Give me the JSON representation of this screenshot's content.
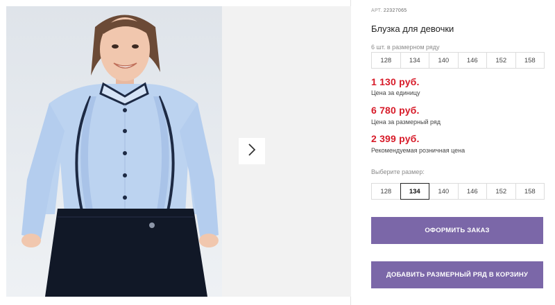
{
  "product": {
    "article_label": "АРТ.",
    "article_number": "22327065",
    "title": "Блузка для девочки"
  },
  "pack": {
    "caption": "6 шт. в размерном ряду",
    "sizes": [
      "128",
      "134",
      "140",
      "146",
      "152",
      "158"
    ]
  },
  "prices": [
    {
      "amount": "1 130 руб.",
      "caption": "Цена за единицу"
    },
    {
      "amount": "6 780 руб.",
      "caption": "Цена за размерный ряд"
    },
    {
      "amount": "2 399 руб.",
      "caption": "Рекомендуемая розничная цена"
    }
  ],
  "size_select": {
    "caption": "Выберите размер:",
    "sizes": [
      "128",
      "134",
      "140",
      "146",
      "152",
      "158"
    ],
    "selected": "134"
  },
  "buttons": {
    "order": "ОФОРМИТЬ ЗАКАЗ",
    "add_pack": "ДОБАВИТЬ РАЗМЕРНЫЙ РЯД В КОРЗИНУ"
  },
  "colors": {
    "price": "#d71a28",
    "button": "#7b67a8",
    "selected_border": "#222222"
  },
  "icons": {
    "next": "chevron-right-icon"
  }
}
